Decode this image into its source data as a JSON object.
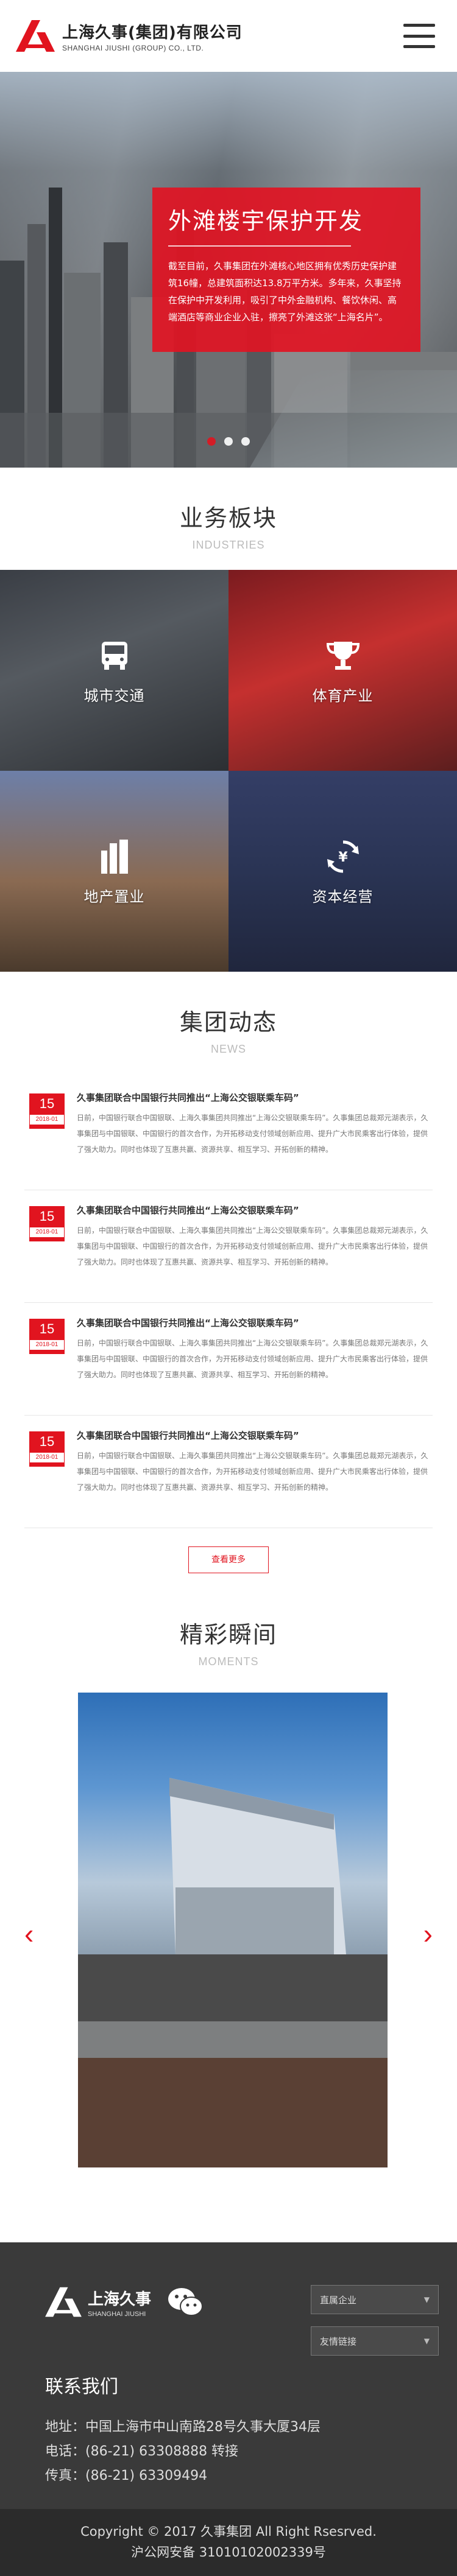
{
  "header": {
    "logo_cn": "上海久事(集团)有限公司",
    "logo_en": "SHANGHAI JIUSHI (GROUP) CO., LTD."
  },
  "hero": {
    "title": "外滩楼宇保护开发",
    "text": "截至目前，久事集团在外滩核心地区拥有优秀历史保护建筑16幢，总建筑面积达13.8万平方米。多年来，久事坚持在保护中开发利用，吸引了中外金融机构、餐饮休闲、高端酒店等商业企业入驻，擦亮了外滩这张“上海名片”。",
    "slide_count": 3,
    "active_slide": 1
  },
  "business": {
    "title": "业务板块",
    "subtitle": "INDUSTRIES",
    "items": [
      {
        "label": "城市交通",
        "icon": "bus-icon"
      },
      {
        "label": "体育产业",
        "icon": "trophy-icon"
      },
      {
        "label": "地产置业",
        "icon": "building-icon"
      },
      {
        "label": "资本经营",
        "icon": "money-cycle-icon"
      }
    ]
  },
  "news": {
    "title": "集团动态",
    "subtitle": "NEWS",
    "items": [
      {
        "day": "15",
        "ym": "2018-01",
        "title": "久事集团联合中国银行共同推出“上海公交银联乘车码”",
        "summary": "日前，中国银行联合中国银联、上海久事集团共同推出“上海公交银联乘车码”。久事集团总裁郑元湖表示，久事集团与中国银联、中国银行的首次合作，为开拓移动支付领域创新应用、提升广大市民乘客出行体验，提供了强大助力。同时也体现了互惠共赢、资源共享、相互学习、开拓创新的精神。"
      },
      {
        "day": "15",
        "ym": "2018-01",
        "title": "久事集团联合中国银行共同推出“上海公交银联乘车码”",
        "summary": "日前，中国银行联合中国银联、上海久事集团共同推出“上海公交银联乘车码”。久事集团总裁郑元湖表示，久事集团与中国银联、中国银行的首次合作，为开拓移动支付领域创新应用、提升广大市民乘客出行体验，提供了强大助力。同时也体现了互惠共赢、资源共享、相互学习、开拓创新的精神。"
      },
      {
        "day": "15",
        "ym": "2018-01",
        "title": "久事集团联合中国银行共同推出“上海公交银联乘车码”",
        "summary": "日前，中国银行联合中国银联、上海久事集团共同推出“上海公交银联乘车码”。久事集团总裁郑元湖表示，久事集团与中国银联、中国银行的首次合作，为开拓移动支付领域创新应用、提升广大市民乘客出行体验，提供了强大助力。同时也体现了互惠共赢、资源共享、相互学习、开拓创新的精神。"
      },
      {
        "day": "15",
        "ym": "2018-01",
        "title": "久事集团联合中国银行共同推出“上海公交银联乘车码”",
        "summary": "日前，中国银行联合中国银联、上海久事集团共同推出“上海公交银联乘车码”。久事集团总裁郑元湖表示，久事集团与中国银联、中国银行的首次合作，为开拓移动支付领域创新应用、提升广大市民乘客出行体验，提供了强大助力。同时也体现了互惠共赢、资源共享、相互学习、开拓创新的精神。"
      }
    ],
    "more_label": "查看更多"
  },
  "moments": {
    "title": "精彩瞬间",
    "subtitle": "MOMENTS"
  },
  "footer": {
    "logo_cn": "上海久事",
    "logo_en": "SHANGHAI JIUSHI",
    "select1": "直属企业",
    "select2": "友情链接",
    "contact_title": "联系我们",
    "address": "地址：中国上海市中山南路28号久事大厦34层",
    "phone": "电话：(86-21) 63308888 转接",
    "fax": "传真：(86-21) 63309494",
    "copyright": "Copyright © 2017 久事集团 All Right Rsesrved.",
    "icp": "沪公网安备 31010102002339号"
  },
  "colors": {
    "accent": "#e1141f",
    "footer_bg": "#3a3a3a"
  }
}
